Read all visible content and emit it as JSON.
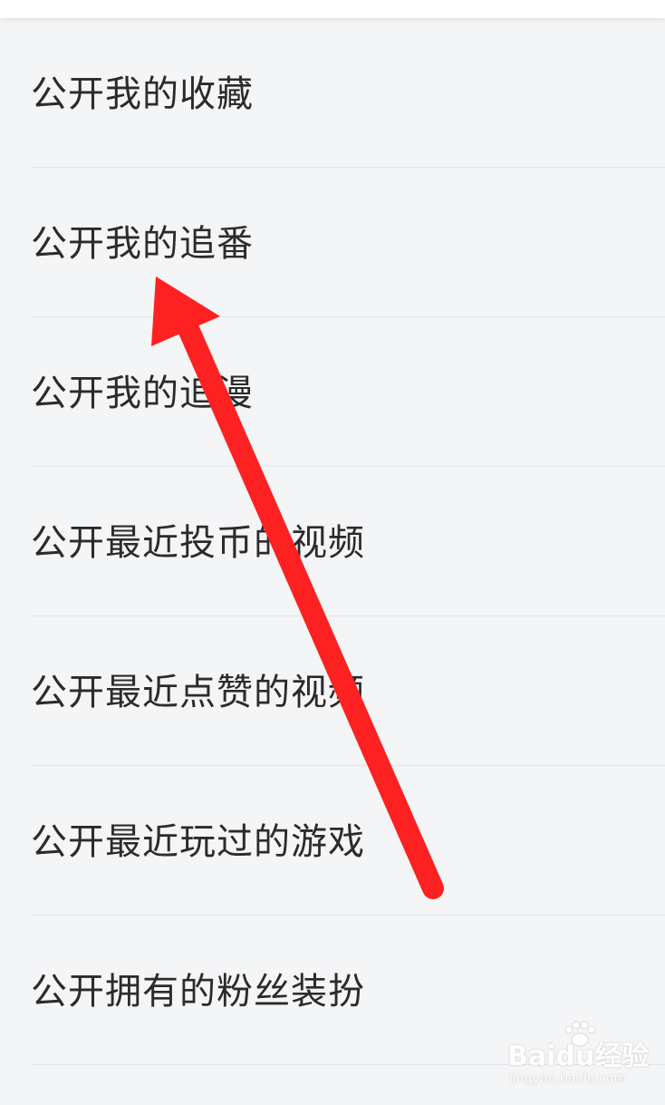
{
  "colors": {
    "background": "#f4f5f7",
    "text": "#2b2b2b",
    "divider": "#e4e5e8",
    "arrow": "#fd2121"
  },
  "settings": {
    "items": [
      {
        "label": "公开我的收藏"
      },
      {
        "label": "公开我的追番"
      },
      {
        "label": "公开我的追漫"
      },
      {
        "label": "公开最近投币的视频"
      },
      {
        "label": "公开最近点赞的视频"
      },
      {
        "label": "公开最近玩过的游戏"
      },
      {
        "label": "公开拥有的粉丝装扮"
      }
    ]
  },
  "annotation": {
    "icon": "red-arrow-icon",
    "points_to": "公开我的追番"
  },
  "watermark": {
    "logo_text": "Baidu经验",
    "url_text": "jingyan.baidu.com"
  }
}
